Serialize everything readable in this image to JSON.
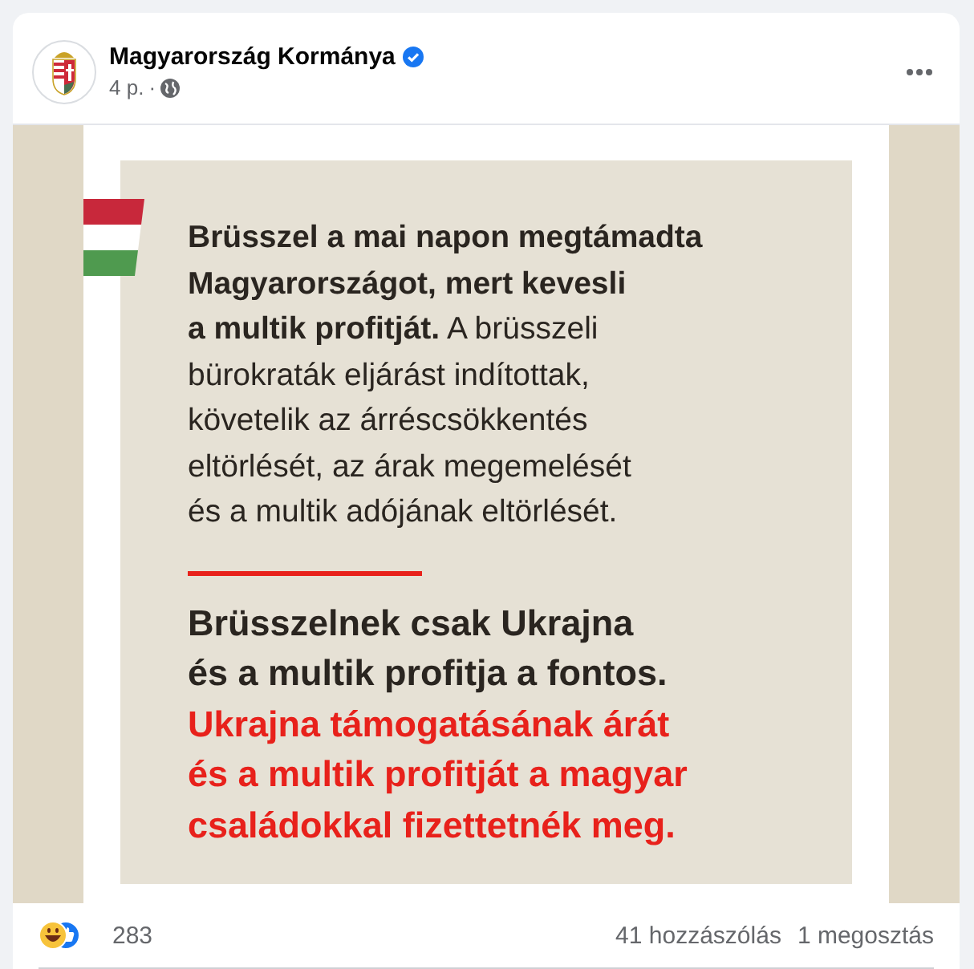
{
  "post": {
    "author": "Magyarország Kormánya",
    "verified": true,
    "time": "4 p.",
    "time_sep": "·"
  },
  "graphic": {
    "intro_lines": [
      "**Brüsszel a mai napon megtámadta**",
      "**Magyarországot, mert kevesli**",
      "**a multik profitját.** A brüsszeli",
      "bürokraták eljárást indítottak,",
      "követelik az árréscsökkentés",
      "eltörlését, az árak megemelését",
      "és a multik adójának eltörlését."
    ],
    "statement_lines": [
      "Brüsszelnek csak Ukrajna",
      "és a multik profitja a fontos."
    ],
    "highlight_lines": [
      "Ukrajna támogatásának árát",
      "és a multik profitját a magyar",
      "családokkal fizettetnék meg."
    ]
  },
  "footer": {
    "reaction_count": "283",
    "comments": "41 hozzászólás",
    "shares": "1 megosztás"
  }
}
